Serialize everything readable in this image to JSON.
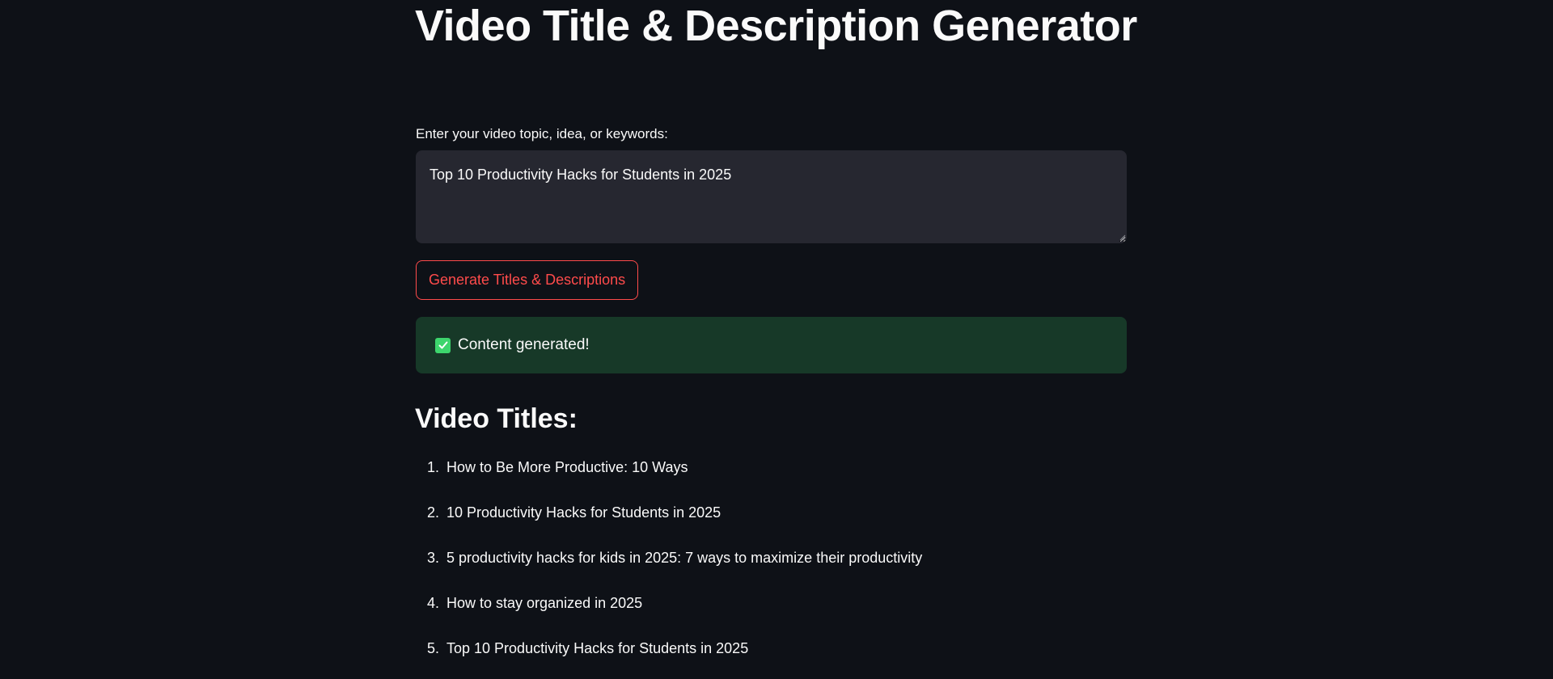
{
  "page": {
    "title": "Video Title & Description Generator"
  },
  "input": {
    "label": "Enter your video topic, idea, or keywords:",
    "value": "Top 10 Productivity Hacks for Students in 2025"
  },
  "generate_button": {
    "label": "Generate Titles & Descriptions"
  },
  "alert": {
    "icon": "check-mark-icon",
    "text": "Content generated!"
  },
  "titles_section": {
    "heading": "Video Titles:",
    "items": [
      {
        "number": "1.",
        "text": "How to Be More Productive: 10 Ways"
      },
      {
        "number": "2.",
        "text": "10 Productivity Hacks for Students in 2025"
      },
      {
        "number": "3.",
        "text": "5 productivity hacks for kids in 2025: 7 ways to maximize their productivity"
      },
      {
        "number": "4.",
        "text": "How to stay organized in 2025"
      },
      {
        "number": "5.",
        "text": "Top 10 Productivity Hacks for Students in 2025"
      }
    ]
  },
  "colors": {
    "background": "#0e1117",
    "text": "#fafafa",
    "input_background": "#262730",
    "primary": "#ff4b4b",
    "success_background": "#173928",
    "success_icon": "#3dd56d"
  }
}
